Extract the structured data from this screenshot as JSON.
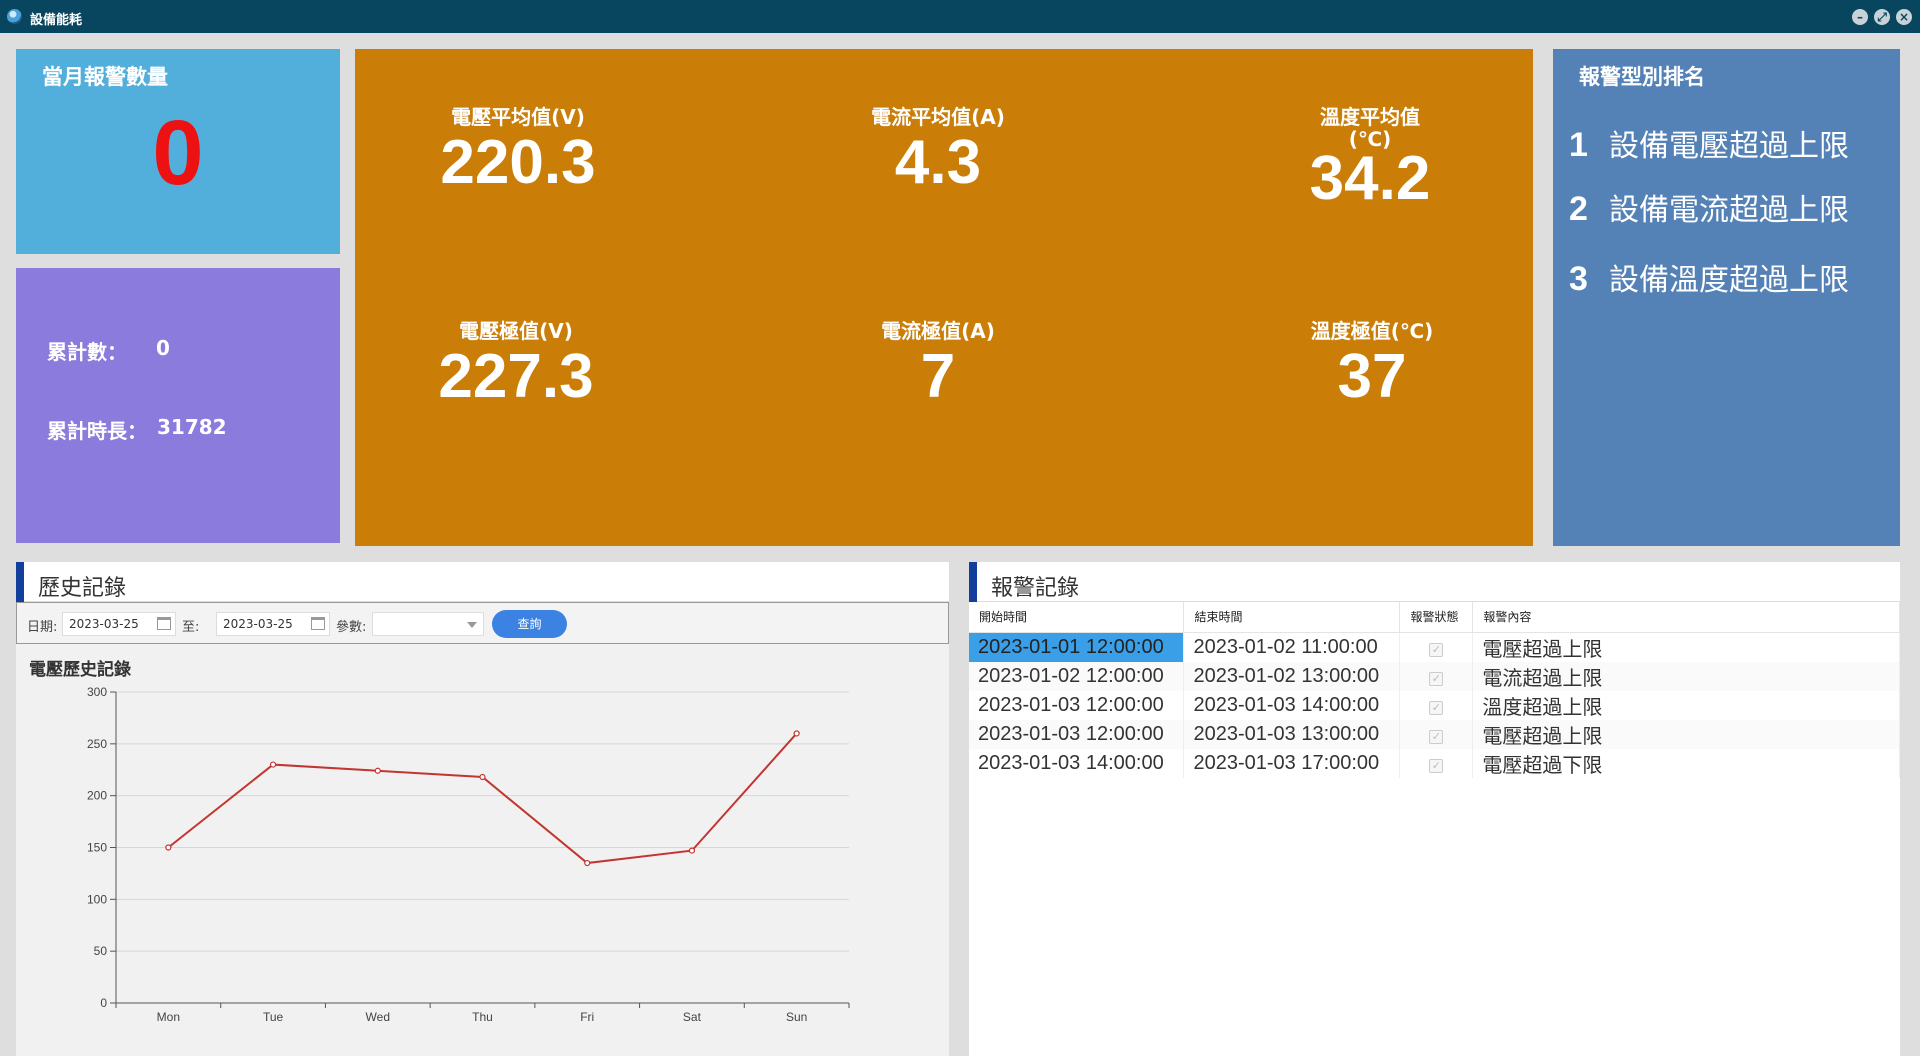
{
  "window": {
    "title": "設備能耗",
    "buttons": [
      "minimize",
      "maximize",
      "close"
    ]
  },
  "alarm_count": {
    "title": "當月報警數量",
    "value": "0"
  },
  "totals": {
    "count_label": "累計數：",
    "count_value": "0",
    "duration_label": "累計時長：",
    "duration_value": "31782"
  },
  "stats": [
    {
      "label": "電壓平均值(V)",
      "value": "220.3"
    },
    {
      "label": "電流平均值(A)",
      "value": "4.3"
    },
    {
      "label": "溫度平均值(℃)",
      "value": "34.2"
    },
    {
      "label": "電壓極值(V)",
      "value": "227.3"
    },
    {
      "label": "電流極值(A)",
      "value": "7"
    },
    {
      "label": "溫度極值(℃)",
      "value": "37"
    }
  ],
  "ranking": {
    "title": "報警型別排名",
    "items": [
      {
        "rank": "1",
        "label": "設備電壓超過上限"
      },
      {
        "rank": "2",
        "label": "設備電流超過上限"
      },
      {
        "rank": "3",
        "label": "設備溫度超過上限"
      }
    ]
  },
  "history": {
    "title": "歷史記錄",
    "date_label": "日期:",
    "date_from": "2023-03-25",
    "to_label": "至:",
    "date_to": "2023-03-25",
    "param_label": "參數:",
    "param_value": "",
    "query_button": "查詢",
    "chart_title": "電壓歷史記錄"
  },
  "chart_data": {
    "type": "line",
    "categories": [
      "Mon",
      "Tue",
      "Wed",
      "Thu",
      "Fri",
      "Sat",
      "Sun"
    ],
    "series": [
      {
        "values": [
          150,
          230,
          224,
          218,
          135,
          147,
          260
        ]
      }
    ],
    "ylim": [
      0,
      300
    ],
    "yticks": [
      0,
      50,
      100,
      150,
      200,
      250,
      300
    ],
    "grid": true,
    "color": "#c23531"
  },
  "alarm_log": {
    "title": "報警記錄",
    "columns": [
      "開始時間",
      "結束時間",
      "報警狀態",
      "報警內容"
    ],
    "rows": [
      {
        "start": "2023-01-01 12:00:00",
        "end": "2023-01-02 11:00:00",
        "status": true,
        "content": "電壓超過上限"
      },
      {
        "start": "2023-01-02 12:00:00",
        "end": "2023-01-02 13:00:00",
        "status": true,
        "content": "電流超過上限"
      },
      {
        "start": "2023-01-03 12:00:00",
        "end": "2023-01-03 14:00:00",
        "status": true,
        "content": "溫度超過上限"
      },
      {
        "start": "2023-01-03 12:00:00",
        "end": "2023-01-03 13:00:00",
        "status": true,
        "content": "電壓超過上限"
      },
      {
        "start": "2023-01-03 14:00:00",
        "end": "2023-01-03 17:00:00",
        "status": true,
        "content": "電壓超過下限"
      }
    ]
  }
}
